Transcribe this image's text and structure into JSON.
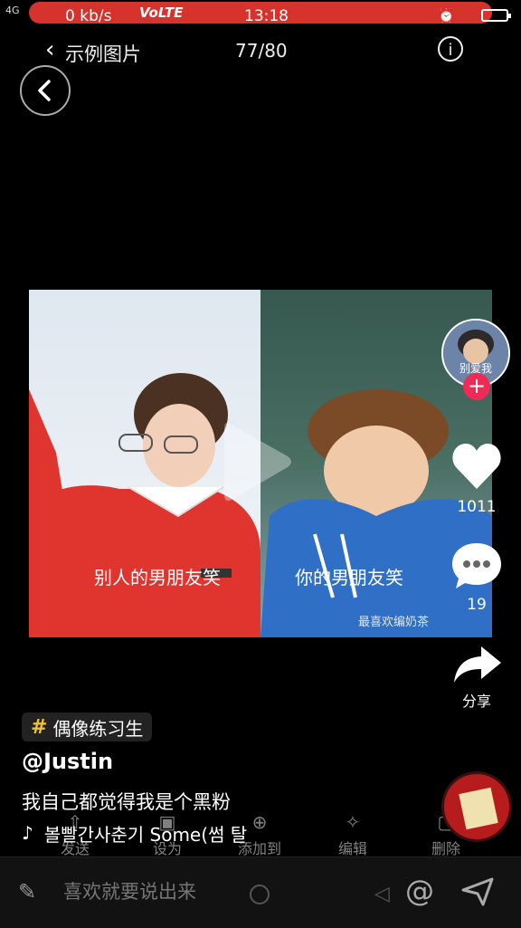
{
  "status_bar": {
    "network": "4G",
    "speed": "0 kb/s",
    "volte": "VoLTE",
    "time": "13:18"
  },
  "header": {
    "back_label": "示例图片",
    "counter": "77/80",
    "info_label": "i"
  },
  "video": {
    "caption_left": "别人的男朋友笑",
    "caption_right": "你的男朋友笑",
    "watermark": "最喜欢编奶茶"
  },
  "sidebar": {
    "avatar_text": "别爱我",
    "likes": "1011",
    "comments": "19",
    "share_label": "分享"
  },
  "post": {
    "hashtag": "偶像练习生",
    "username": "@Justin",
    "description": "我自己都觉得我是个黑粉",
    "music": "볼빨간사춘기 Some(썸 탈"
  },
  "ghost_actions": [
    "发送",
    "设为",
    "添加到",
    "编辑",
    "删除"
  ],
  "comment_bar": {
    "placeholder": "喜欢就要说出来"
  },
  "colors": {
    "status_bar": "#d6332d",
    "follow": "#ee2b55",
    "hashtag_symbol": "#f2c02c"
  }
}
